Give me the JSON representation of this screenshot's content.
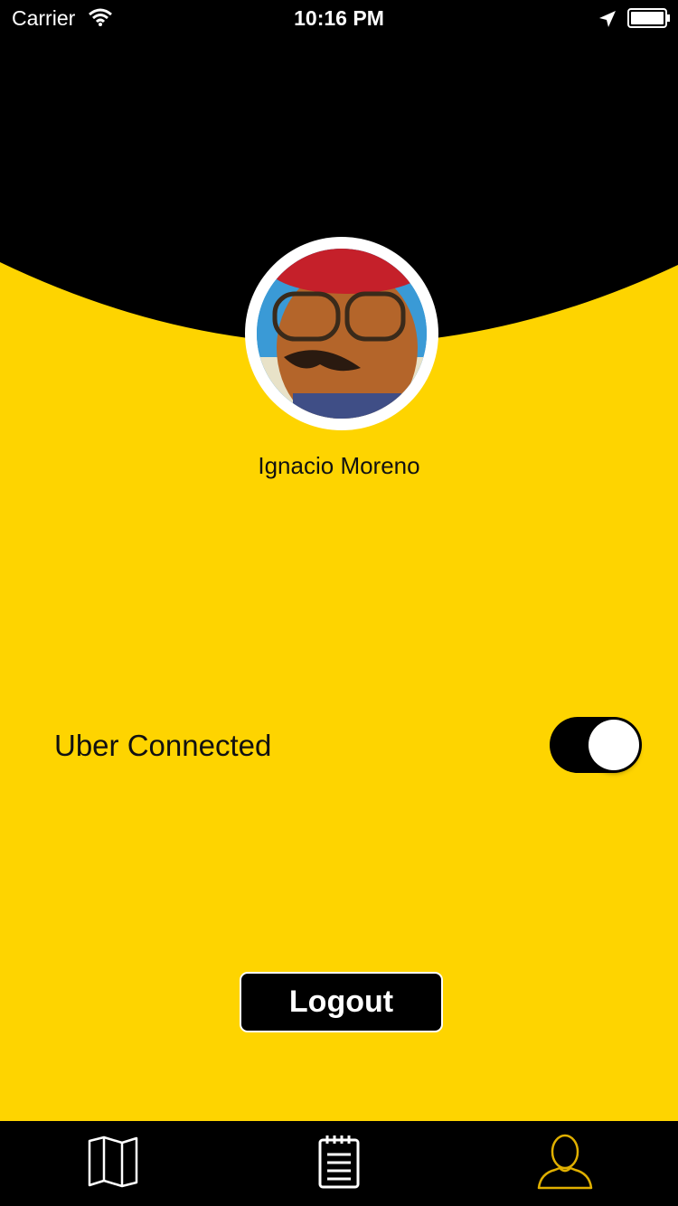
{
  "status_bar": {
    "carrier": "Carrier",
    "time": "10:16 PM"
  },
  "profile": {
    "name": "Ignacio Moreno"
  },
  "settings": {
    "uber_label": "Uber Connected",
    "uber_toggle_on": true
  },
  "actions": {
    "logout_label": "Logout"
  },
  "tab_bar": {
    "tabs": [
      {
        "icon": "map-icon",
        "active": false
      },
      {
        "icon": "notepad-icon",
        "active": false
      },
      {
        "icon": "profile-icon",
        "active": true
      }
    ]
  },
  "colors": {
    "background": "#FED400",
    "header": "#000000",
    "tab_active": "#E0B000",
    "tab_inactive": "#FFFFFF"
  }
}
